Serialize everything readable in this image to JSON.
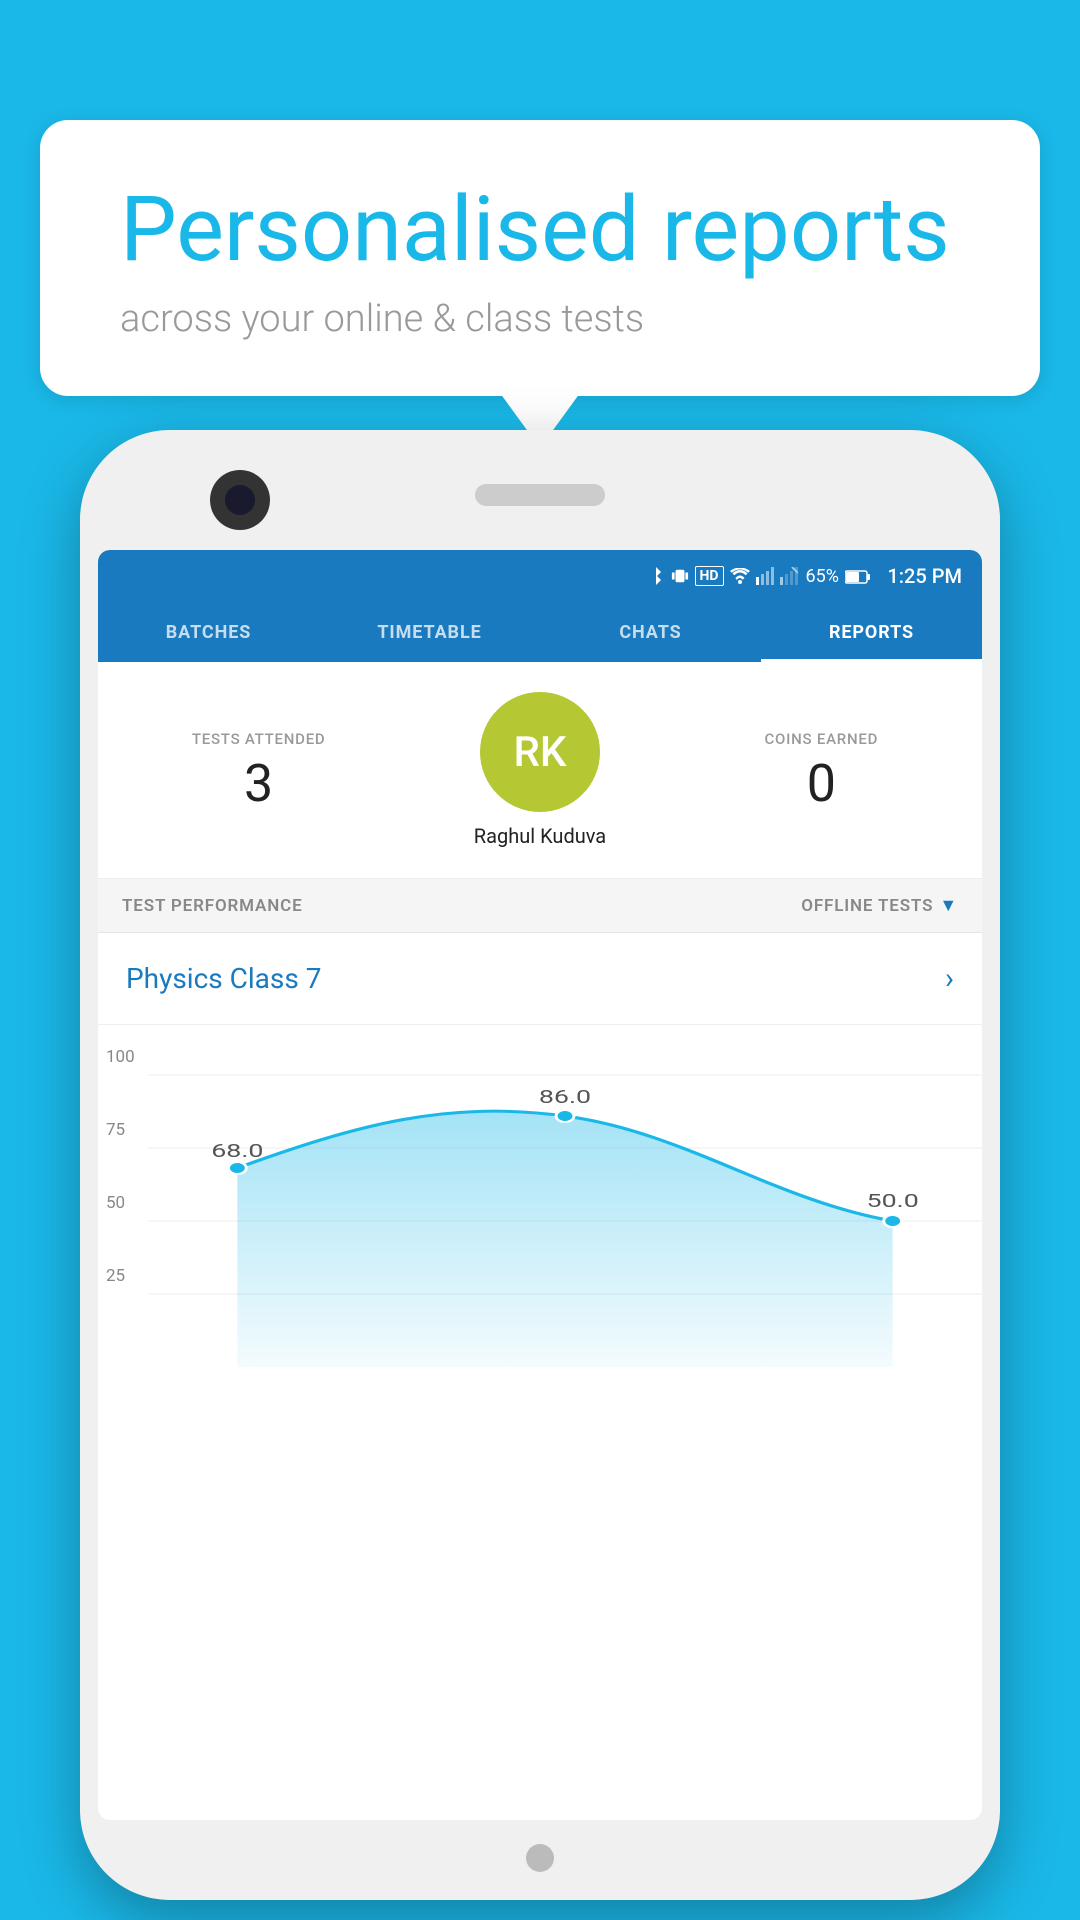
{
  "background_color": "#1ab8e8",
  "bubble": {
    "title": "Personalised reports",
    "subtitle": "across your online & class tests"
  },
  "status_bar": {
    "battery_percent": "65%",
    "time": "1:25 PM"
  },
  "nav_tabs": [
    {
      "id": "batches",
      "label": "BATCHES",
      "active": false
    },
    {
      "id": "timetable",
      "label": "TIMETABLE",
      "active": false
    },
    {
      "id": "chats",
      "label": "CHATS",
      "active": false
    },
    {
      "id": "reports",
      "label": "REPORTS",
      "active": true
    }
  ],
  "profile": {
    "tests_attended_label": "TESTS ATTENDED",
    "tests_attended_value": "3",
    "coins_earned_label": "COINS EARNED",
    "coins_earned_value": "0",
    "avatar_initials": "RK",
    "avatar_name": "Raghul Kuduva"
  },
  "performance": {
    "section_label": "TEST PERFORMANCE",
    "dropdown_label": "OFFLINE TESTS",
    "class_name": "Physics Class 7",
    "chart": {
      "y_labels": [
        "100",
        "75",
        "50",
        "25"
      ],
      "data_points": [
        {
          "label": "68.0",
          "value": 68
        },
        {
          "label": "86.0",
          "value": 86
        },
        {
          "label": "50.0",
          "value": 50
        }
      ]
    }
  }
}
